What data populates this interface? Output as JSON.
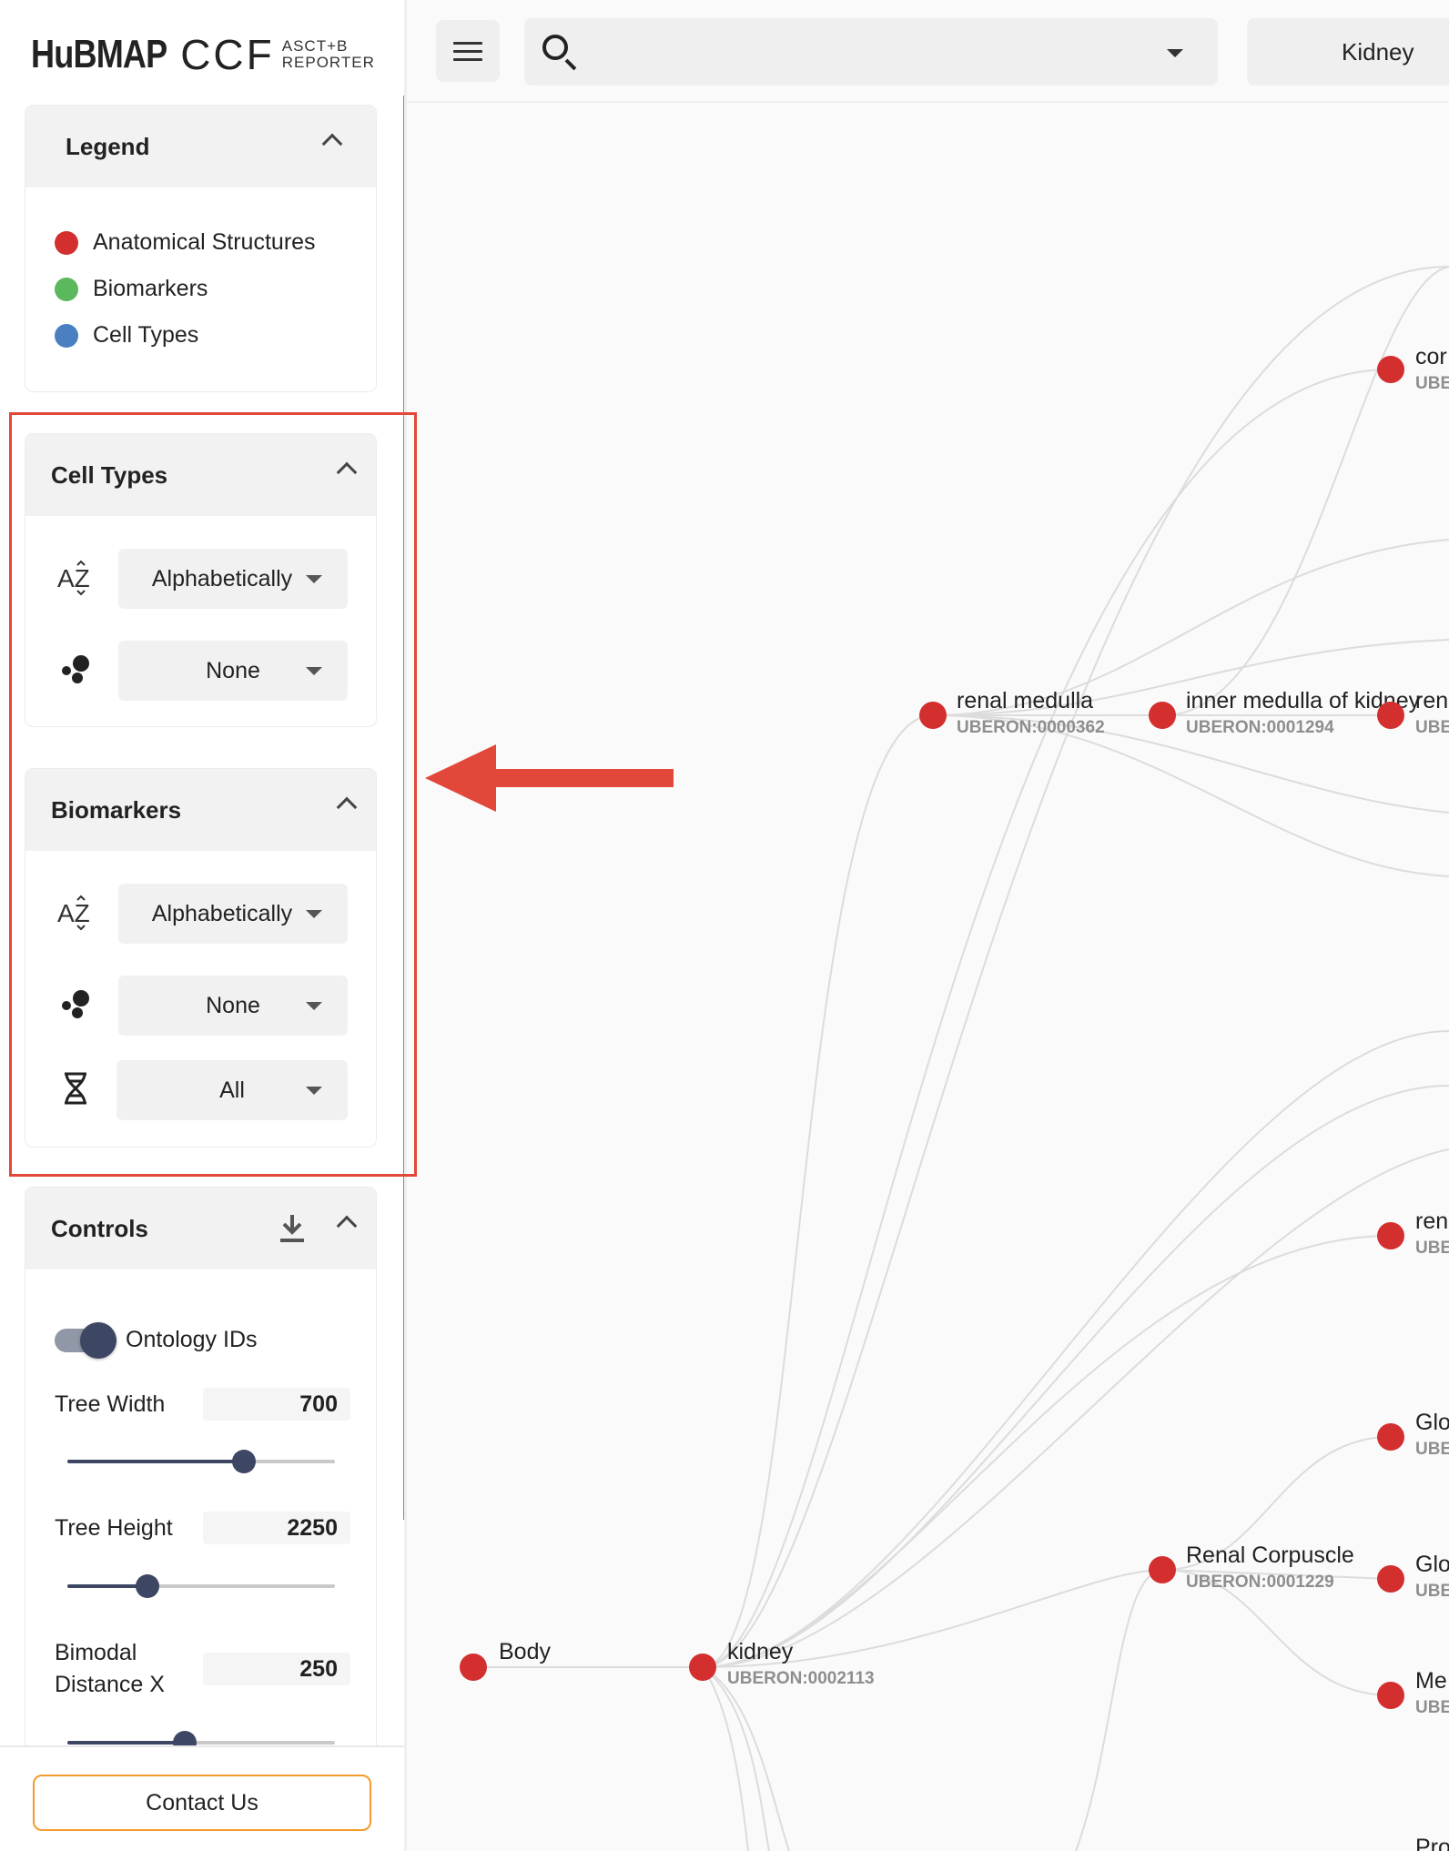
{
  "logo": {
    "brand": "HuBMAP",
    "product": "CCF",
    "sub_line1": "ASCT+B",
    "sub_line2": "REPORTER"
  },
  "legend": {
    "title": "Legend",
    "items": [
      {
        "label": "Anatomical Structures",
        "color": "#d32f2f"
      },
      {
        "label": "Biomarkers",
        "color": "#5cb85c"
      },
      {
        "label": "Cell Types",
        "color": "#4a7fc1"
      }
    ]
  },
  "cell_types": {
    "title": "Cell Types",
    "sort_value": "Alphabetically",
    "size_value": "None"
  },
  "biomarkers": {
    "title": "Biomarkers",
    "sort_value": "Alphabetically",
    "size_value": "None",
    "type_value": "All"
  },
  "controls": {
    "title": "Controls",
    "ontology_label": "Ontology IDs",
    "ontology_on": true,
    "tree_width_label": "Tree Width",
    "tree_width": "700",
    "tree_width_fraction": 0.66,
    "tree_height_label": "Tree Height",
    "tree_height": "2250",
    "tree_height_fraction": 0.3,
    "bimodal_label_line1": "Bimodal",
    "bimodal_label_line2": "Distance X",
    "bimodal_distance": "250",
    "bimodal_fraction": 0.44
  },
  "contact_label": "Contact Us",
  "topbar": {
    "organ": "Kidney"
  },
  "colors": {
    "anatomical": "#d32f2f",
    "accent": "#f39c2d",
    "annotation": "#e2483a",
    "slider": "#3d4663"
  },
  "graph": {
    "nodes": [
      {
        "name": "Body",
        "id": ""
      },
      {
        "name": "kidney",
        "id": "UBERON:0002113"
      },
      {
        "name": "renal medulla",
        "id": "UBERON:0000362"
      },
      {
        "name": "inner medulla of kidney",
        "id": "UBERON:0001294"
      },
      {
        "name": "Renal Corpuscle",
        "id": "UBERON:0001229"
      },
      {
        "name": "cor",
        "id": "UBE"
      },
      {
        "name": "ren",
        "id": "UBE"
      },
      {
        "name": "ren",
        "id": "UBE"
      },
      {
        "name": "Glo",
        "id": "UBE"
      },
      {
        "name": "Glo",
        "id": "UBE"
      },
      {
        "name": "Me",
        "id": "UBE"
      },
      {
        "name": "Pro",
        "id": ""
      }
    ]
  }
}
